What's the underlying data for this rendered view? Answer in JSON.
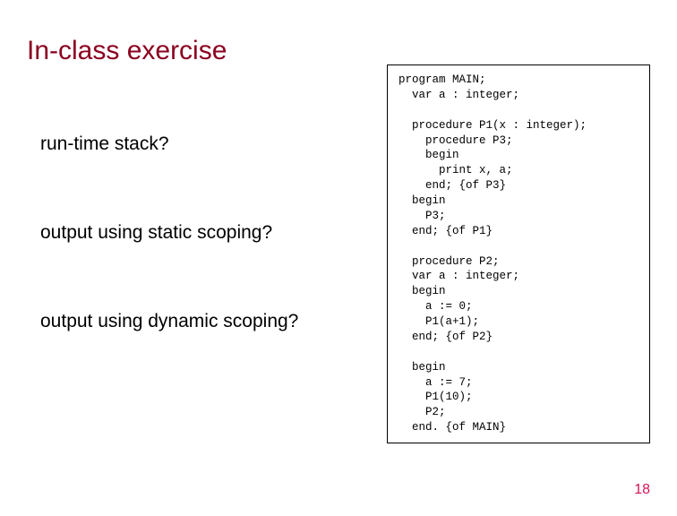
{
  "title": "In-class exercise",
  "questions": {
    "q1": "run-time stack?",
    "q2": "output using static scoping?",
    "q3": "output using dynamic scoping?"
  },
  "code": "program MAIN;\n  var a : integer;\n\n  procedure P1(x : integer);\n    procedure P3;\n    begin\n      print x, a;\n    end; {of P3}\n  begin\n    P3;\n  end; {of P1}\n\n  procedure P2;\n  var a : integer;\n  begin\n    a := 0;\n    P1(a+1);\n  end; {of P2}\n\n  begin\n    a := 7;\n    P1(10);\n    P2;\n  end. {of MAIN}",
  "page_number": "18"
}
